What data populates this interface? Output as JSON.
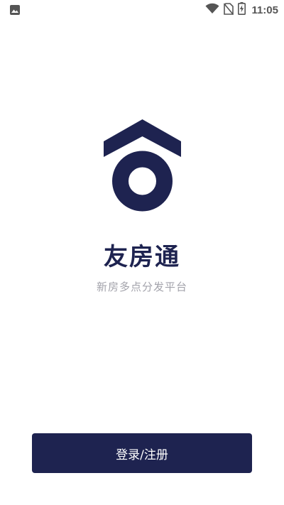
{
  "status_bar": {
    "time": "11:05",
    "icons": [
      "image-icon",
      "wifi-icon",
      "no-sim-icon",
      "battery-charging-icon"
    ]
  },
  "app": {
    "name": "友房通",
    "tagline": "新房多点分发平台",
    "logo_icon": "house-logo-icon"
  },
  "actions": {
    "login_label": "登录/注册"
  },
  "colors": {
    "brand": "#1e2350",
    "tagline": "#a3a3ab",
    "background": "#ffffff"
  }
}
